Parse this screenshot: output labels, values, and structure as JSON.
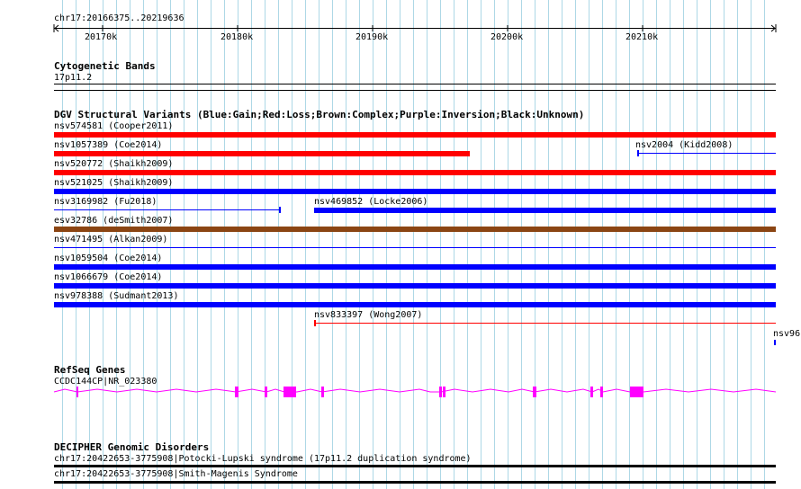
{
  "ruler": {
    "range_label": "chr17:20166375..20219636",
    "ticks": [
      "20170k",
      "20180k",
      "20190k",
      "20200k",
      "20210k"
    ]
  },
  "tracks": {
    "cyto": {
      "title": "Cytogenetic Bands",
      "band": "17p11.2"
    },
    "dgv": {
      "title": "DGV Structural Variants (Blue:Gain;Red:Loss;Brown:Complex;Purple:Inversion;Black:Unknown)",
      "variants": [
        {
          "label": "nsv574581 (Cooper2011)",
          "color": "#ff0000"
        },
        {
          "label": "nsv1057389 (Coe2014)",
          "color": "#ff0000"
        },
        {
          "label": "nsv2004 (Kidd2008)",
          "color": "#0000ff"
        },
        {
          "label": "nsv520772 (Shaikh2009)",
          "color": "#ff0000"
        },
        {
          "label": "nsv521025 (Shaikh2009)",
          "color": "#0000ff"
        },
        {
          "label": "nsv3169982 (Fu2018)",
          "color": "#0000ff"
        },
        {
          "label": "nsv469852 (Locke2006)",
          "color": "#0000ff"
        },
        {
          "label": "esv32786 (deSmith2007)",
          "color": "#8b4513"
        },
        {
          "label": "nsv471495 (Alkan2009)",
          "color": "#0000ff"
        },
        {
          "label": "nsv1059504 (Coe2014)",
          "color": "#0000ff"
        },
        {
          "label": "nsv1066679 (Coe2014)",
          "color": "#0000ff"
        },
        {
          "label": "nsv978388 (Sudmant2013)",
          "color": "#0000ff"
        },
        {
          "label": "nsv833397 (Wong2007)",
          "color": "#ff0000"
        },
        {
          "label": "nsv96",
          "color": "#0000ff"
        }
      ]
    },
    "refseq": {
      "title": "RefSeq Genes",
      "gene": "CCDC144CP|NR_023380",
      "color": "#ff00ff"
    },
    "decipher": {
      "title": "DECIPHER Genomic Disorders",
      "items": [
        "chr17:20422653-3775908|Potocki-Lupski syndrome (17p11.2 duplication syndrome)",
        "chr17:20422653-3775908|Smith-Magenis Syndrome"
      ]
    }
  },
  "colors": {
    "gridline": "#add8e6",
    "gain": "#0000ff",
    "loss": "#ff0000",
    "complex": "#8b4513",
    "gene": "#ff00ff",
    "decipher": "#000000"
  }
}
